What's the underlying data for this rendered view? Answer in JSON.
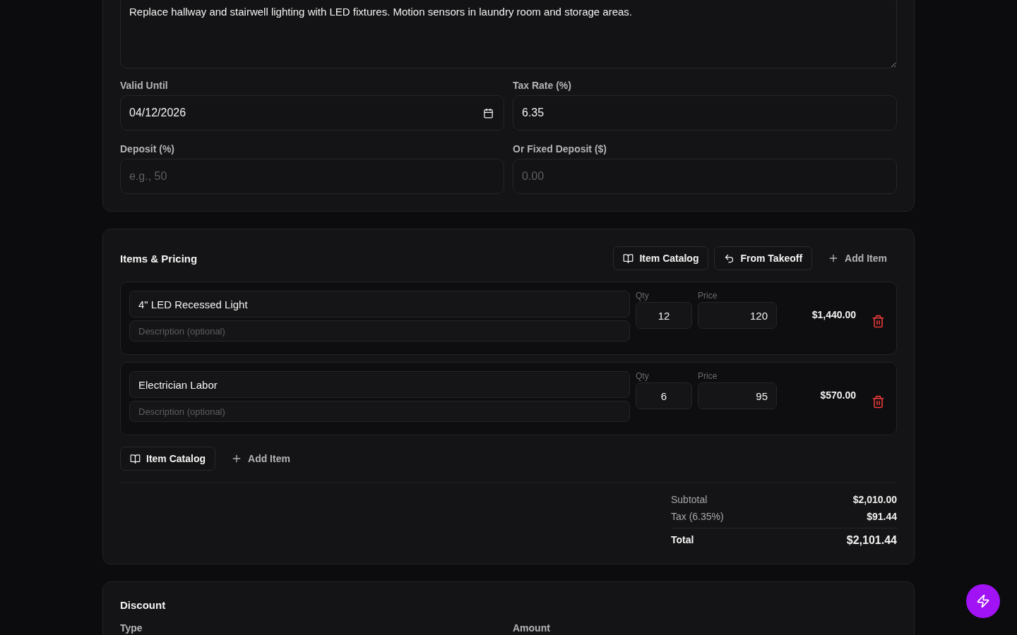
{
  "details": {
    "description": "Replace hallway and stairwell lighting with LED fixtures. Motion sensors in laundry room and storage areas.",
    "fields": [
      {
        "label": "Valid Until",
        "value": "04/12/2026",
        "kind": "date"
      },
      {
        "label": "Tax Rate (%)",
        "value": "6.35",
        "kind": "text"
      },
      {
        "label": "Deposit (%)",
        "placeholder": "e.g., 50",
        "kind": "text"
      },
      {
        "label": "Or Fixed Deposit ($)",
        "placeholder": "0.00",
        "kind": "text"
      }
    ]
  },
  "items": {
    "title": "Items & Pricing",
    "header_actions": [
      {
        "label": "Item Catalog",
        "kind": "catalog"
      },
      {
        "label": "From Takeoff",
        "kind": "takeoff"
      },
      {
        "label": "Add Item",
        "kind": "add"
      }
    ],
    "line_items": [
      {
        "name": "4\" LED Recessed Light",
        "description_placeholder": "Description (optional)",
        "qty_label": "Qty",
        "qty": "12",
        "price_label": "Price",
        "price": "120",
        "amount": "$1,440.00"
      },
      {
        "name": "Electrician Labor",
        "description_placeholder": "Description (optional)",
        "qty_label": "Qty",
        "qty": "6",
        "price_label": "Price",
        "price": "95",
        "amount": "$570.00"
      }
    ],
    "footer_actions": [
      {
        "label": "Item Catalog",
        "kind": "catalog"
      },
      {
        "label": "Add Item",
        "kind": "add"
      }
    ],
    "totals": [
      {
        "label": "Subtotal",
        "value": "$2,010.00",
        "kind": "normal"
      },
      {
        "label": "Tax (6.35%)",
        "value": "$91.44",
        "kind": "normal"
      },
      {
        "label": "Total",
        "value": "$2,101.44",
        "kind": "total"
      }
    ]
  },
  "discount": {
    "title": "Discount",
    "labels": [
      "Type",
      "Amount"
    ]
  }
}
